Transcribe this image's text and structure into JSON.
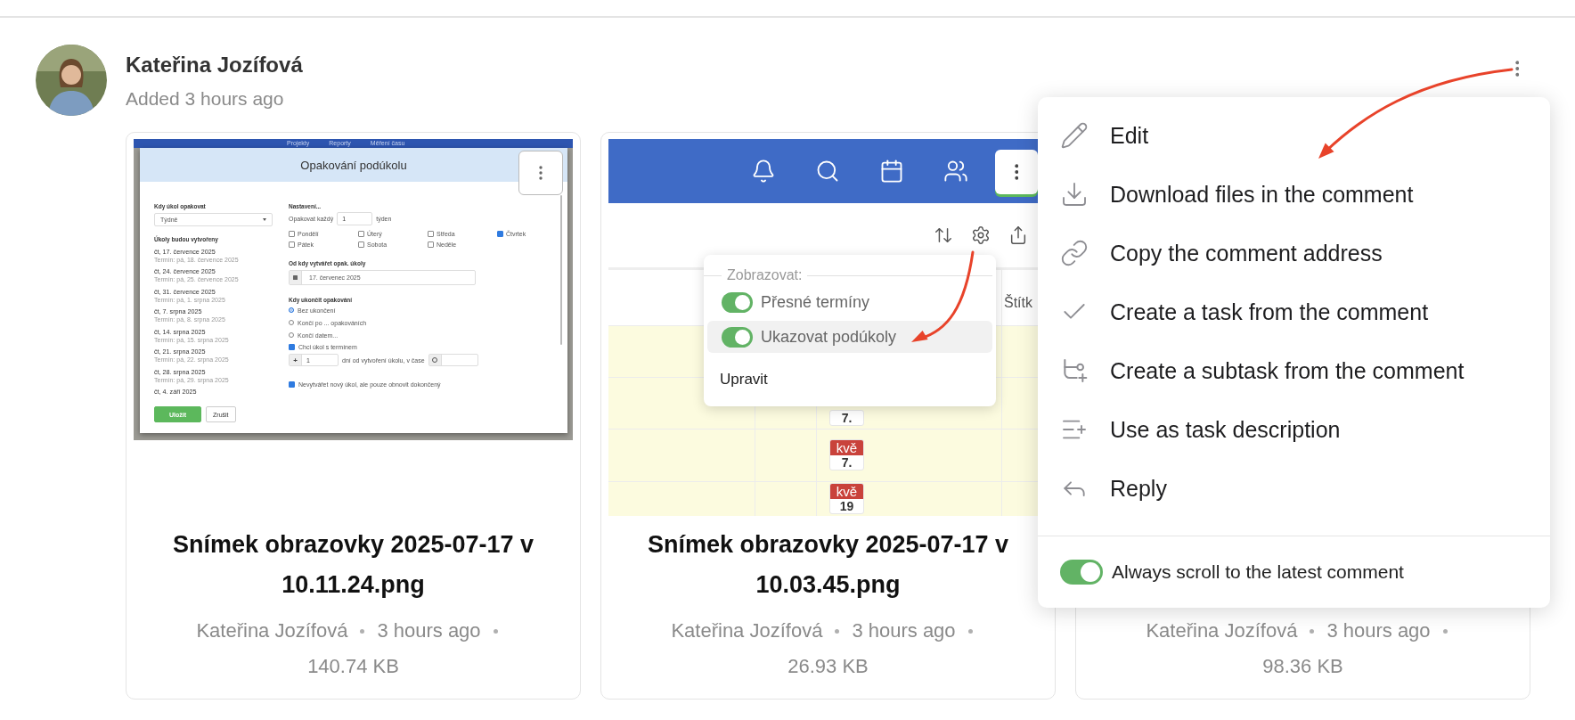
{
  "comment": {
    "author": "Kateřina Jozífová",
    "time": "Added 3 hours ago"
  },
  "attachments": [
    {
      "title": "Snímek obrazovky 2025-07-17 v 10.11.24.png",
      "author": "Kateřina Jozífová",
      "time": "3 hours ago",
      "size": "140.74 KB",
      "preview": {
        "kind": "repeat_dialog",
        "nav": [
          "Projekty",
          "Reporty",
          "Měření času"
        ],
        "title": "Opakování podúkolu",
        "when_label": "Kdy úkol opakovat",
        "frequency": "Týdně",
        "list_label": "Úkoly budou vytvořeny",
        "occurrences": [
          {
            "date": "čt, 17. července 2025",
            "due": "Termín: pá, 18. července 2025"
          },
          {
            "date": "čt, 24. července 2025",
            "due": "Termín: pá, 25. července 2025"
          },
          {
            "date": "čt, 31. července 2025",
            "due": "Termín: pá, 1. srpna 2025"
          },
          {
            "date": "čt, 7. srpna 2025",
            "due": "Termín: pá, 8. srpna 2025"
          },
          {
            "date": "čt, 14. srpna 2025",
            "due": "Termín: pá, 15. srpna 2025"
          },
          {
            "date": "čt, 21. srpna 2025",
            "due": "Termín: pá, 22. srpna 2025"
          },
          {
            "date": "čt, 28. srpna 2025",
            "due": "Termín: pá, 29. srpna 2025"
          },
          {
            "date": "čt, 4. září 2025"
          }
        ],
        "buttons": [
          {
            "label": "Uložit",
            "primary": true
          },
          {
            "label": "Zrušit",
            "primary": false
          }
        ],
        "settings_label": "Nastavení...",
        "repeat_label": "Opakovat každý",
        "repeat_value": "1",
        "repeat_unit": "týden",
        "days": [
          {
            "label": "Pondělí",
            "checked": false
          },
          {
            "label": "Úterý",
            "checked": false
          },
          {
            "label": "Středa",
            "checked": false
          },
          {
            "label": "Čtvrtek",
            "checked": true
          },
          {
            "label": "Pátek",
            "checked": false
          },
          {
            "label": "Sobota",
            "checked": false
          },
          {
            "label": "Neděle",
            "checked": false
          }
        ],
        "start_label": "Od kdy vytvářet opak. úkoly",
        "start_date": "17. červenec 2025",
        "end_label": "Kdy ukončit opakování",
        "end_options": [
          {
            "label": "Bez ukončení",
            "selected": true
          },
          {
            "label": "Končí po ... opakováních",
            "selected": false
          },
          {
            "label": "Končí datem...",
            "selected": false
          }
        ],
        "with_due": {
          "label": "Chci úkol s termínem",
          "checked": true
        },
        "offset_sign": "+",
        "offset_value": "1",
        "offset_label": "dní od vytvoření úkolu, v čase",
        "renew": {
          "label": "Nevytvářet nový úkol, ale pouze obnovit dokončený",
          "checked": true
        }
      }
    },
    {
      "title": "Snímek obrazovky 2025-07-17 v 10.03.45.png",
      "author": "Kateřina Jozífová",
      "time": "3 hours ago",
      "size": "26.93 KB",
      "preview": {
        "kind": "list_settings",
        "table_header": "Štítk",
        "display_label": "Zobrazovat:",
        "toggles": [
          {
            "label": "Přesné termíny",
            "on": true,
            "highlighted": false
          },
          {
            "label": "Ukazovat podúkoly",
            "on": true,
            "highlighted": true
          }
        ],
        "edit_label": "Upravit",
        "date_badges": [
          {
            "day": "7."
          },
          {
            "month": "kvě",
            "day": "7."
          },
          {
            "month": "kvě",
            "day": "19"
          }
        ]
      }
    },
    {
      "author": "Kateřina Jozífová",
      "time": "3 hours ago",
      "size": "98.36 KB"
    }
  ],
  "menu": {
    "items": [
      {
        "label": "Edit"
      },
      {
        "label": "Download files in the comment"
      },
      {
        "label": "Copy the comment address"
      },
      {
        "label": "Create a task from the comment"
      },
      {
        "label": "Create a subtask from the comment"
      },
      {
        "label": "Use as task description"
      },
      {
        "label": "Reply"
      }
    ],
    "footer_toggle": {
      "label": "Always scroll to the latest comment",
      "on": true
    }
  }
}
